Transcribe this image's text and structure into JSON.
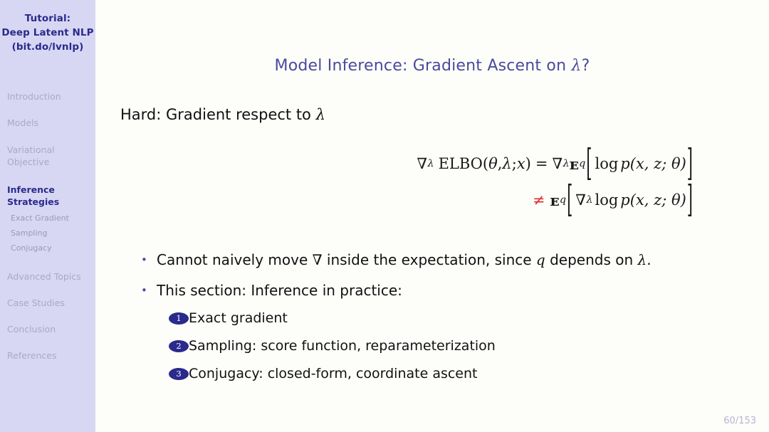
{
  "sidebar": {
    "title_lines": [
      "Tutorial:",
      "Deep Latent NLP",
      "(bit.do/lvnlp)"
    ],
    "items": [
      {
        "label": "Introduction",
        "state": "inactive",
        "level": 1
      },
      {
        "label": "Models",
        "state": "inactive",
        "level": 1
      },
      {
        "label": "Variational",
        "label2": "Objective",
        "state": "inactive",
        "level": 1
      },
      {
        "label": "Inference",
        "label2": "Strategies",
        "state": "active",
        "level": 1
      },
      {
        "label": "Exact Gradient",
        "state": "sub",
        "level": 2
      },
      {
        "label": "Sampling",
        "state": "sub",
        "level": 2
      },
      {
        "label": "Conjugacy",
        "state": "sub",
        "level": 2
      },
      {
        "label": "Advanced Topics",
        "state": "inactive",
        "level": 1
      },
      {
        "label": "Case Studies",
        "state": "inactive",
        "level": 1
      },
      {
        "label": "Conclusion",
        "state": "inactive",
        "level": 1
      },
      {
        "label": "References",
        "state": "inactive",
        "level": 1
      }
    ],
    "colors": {
      "background": "#d7d7f4",
      "active": "#2a2a8c",
      "inactive": "#a9a9c8",
      "sub": "#9a9ab8"
    }
  },
  "slide": {
    "title_main": "Model Inference:  Gradient Ascent on ",
    "title_symbol": "λ",
    "title_suffix": "?",
    "title_color": "#4a4a9c",
    "intro_label": "Hard:  Gradient respect to ",
    "intro_symbol": "λ"
  },
  "equation": {
    "line1": {
      "nabla": "∇",
      "nabla_sub": "λ",
      "elbo": "ELBO(",
      "theta": "θ",
      "comma1": ", ",
      "lambda": "λ",
      "semi": "; ",
      "x": "x",
      "close": ")",
      "equals": "=",
      "nabla2": "∇",
      "nabla2_sub": "λ",
      "expect": "ᴇ",
      "expect_sub": "q",
      "bracket_open": "[",
      "log": "log",
      "p": "p",
      "args": "(x, z; θ)",
      "bracket_close": "]"
    },
    "line2": {
      "neq": "≠",
      "neq_color": "#e03030",
      "expect": "ᴇ",
      "expect_sub": "q",
      "bracket_open": "[",
      "nabla": "∇",
      "nabla_sub": "λ",
      "log": "log",
      "p": "p",
      "args": "(x, z; θ)",
      "bracket_close": "]"
    }
  },
  "bullets": [
    {
      "marker": "•",
      "pre": "Cannot naively move ",
      "symbol": "∇",
      "mid": " inside the expectation, since ",
      "symbol2": "q",
      "post": " depends on ",
      "symbol3": "λ",
      "end": "."
    },
    {
      "marker": "•",
      "pre": "This section:  Inference in practice:",
      "symbol": "",
      "mid": "",
      "symbol2": "",
      "post": "",
      "symbol3": "",
      "end": ""
    }
  ],
  "enumerated": [
    {
      "number": "1",
      "text": "Exact gradient"
    },
    {
      "number": "2",
      "text": "Sampling:  score function, reparameterization"
    },
    {
      "number": "3",
      "text": "Conjugacy:  closed-form, coordinate ascent"
    }
  ],
  "footer": {
    "page_number": "60/153"
  }
}
